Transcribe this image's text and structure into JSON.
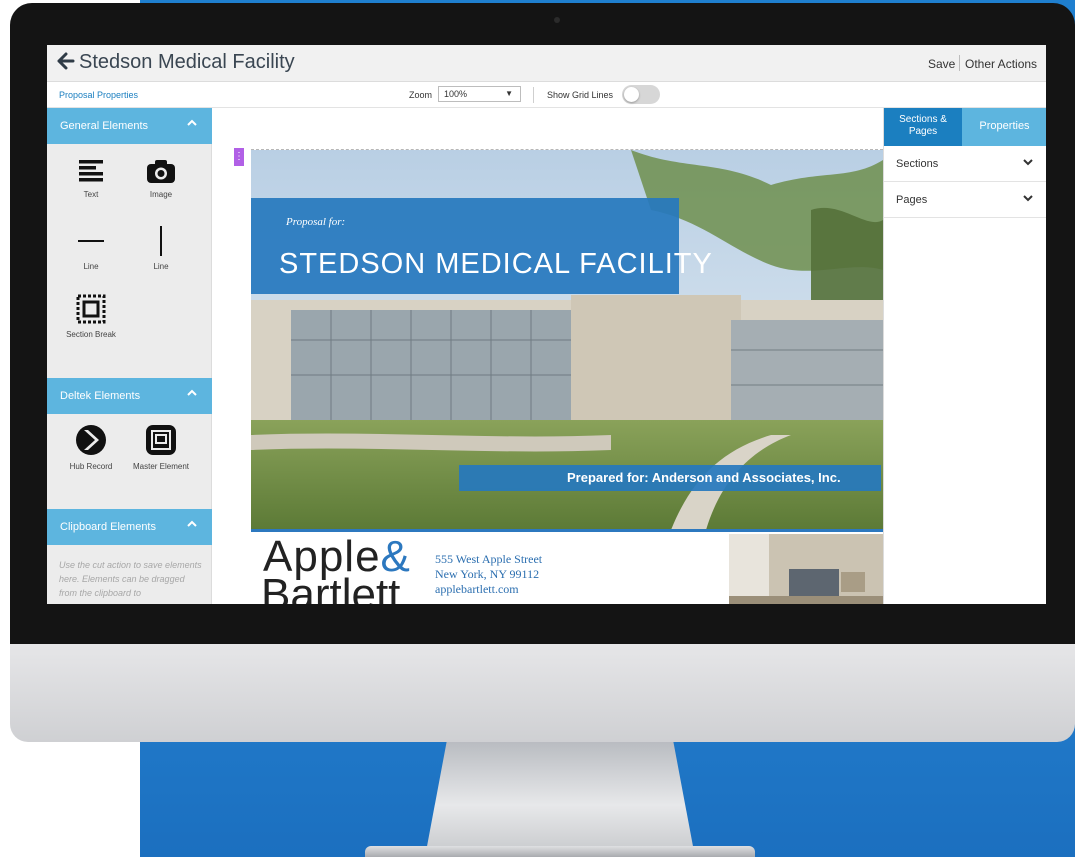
{
  "header": {
    "back_icon": "arrow-left-icon",
    "title": "Stedson Medical Facility",
    "save_label": "Save",
    "other_actions_label": "Other Actions"
  },
  "toolbar": {
    "proposal_properties_label": "Proposal Properties",
    "zoom_label": "Zoom",
    "zoom_value": "100%",
    "show_grid_label": "Show Grid Lines",
    "show_grid_on": false
  },
  "left_panel": {
    "general": {
      "title": "General Elements",
      "items": [
        {
          "label": "Text",
          "icon": "text-lines-icon"
        },
        {
          "label": "Image",
          "icon": "camera-icon"
        },
        {
          "label": "Line",
          "icon": "horizontal-line-icon"
        },
        {
          "label": "Line",
          "icon": "vertical-line-icon"
        },
        {
          "label": "Section Break",
          "icon": "section-break-icon"
        }
      ]
    },
    "deltek": {
      "title": "Deltek Elements",
      "items": [
        {
          "label": "Hub Record",
          "icon": "hub-record-icon"
        },
        {
          "label": "Master Element",
          "icon": "master-element-icon"
        }
      ]
    },
    "clipboard": {
      "title": "Clipboard Elements",
      "help_text": "Use the cut action to save elements here. Elements can be dragged from the clipboard to"
    }
  },
  "canvas": {
    "proposal_for": "Proposal for:",
    "project_name": "STEDSON MEDICAL FACILITY",
    "prepared_for": "Prepared for: Anderson and Associates, Inc.",
    "logo_line1": "Apple",
    "logo_amp": "&",
    "logo_line2": "Bartlett",
    "address_line1": "555 West Apple Street",
    "address_line2": "New York, NY 99112",
    "website": "applebartlett.com"
  },
  "right_panel": {
    "tab_sections_pages": "Sections & Pages",
    "tab_properties": "Properties",
    "sections_label": "Sections",
    "pages_label": "Pages"
  },
  "colors": {
    "primary_blue": "#1b7fc0",
    "light_blue": "#5db5df",
    "banner_blue": "#2678be",
    "purple_handle": "#b160e6"
  }
}
